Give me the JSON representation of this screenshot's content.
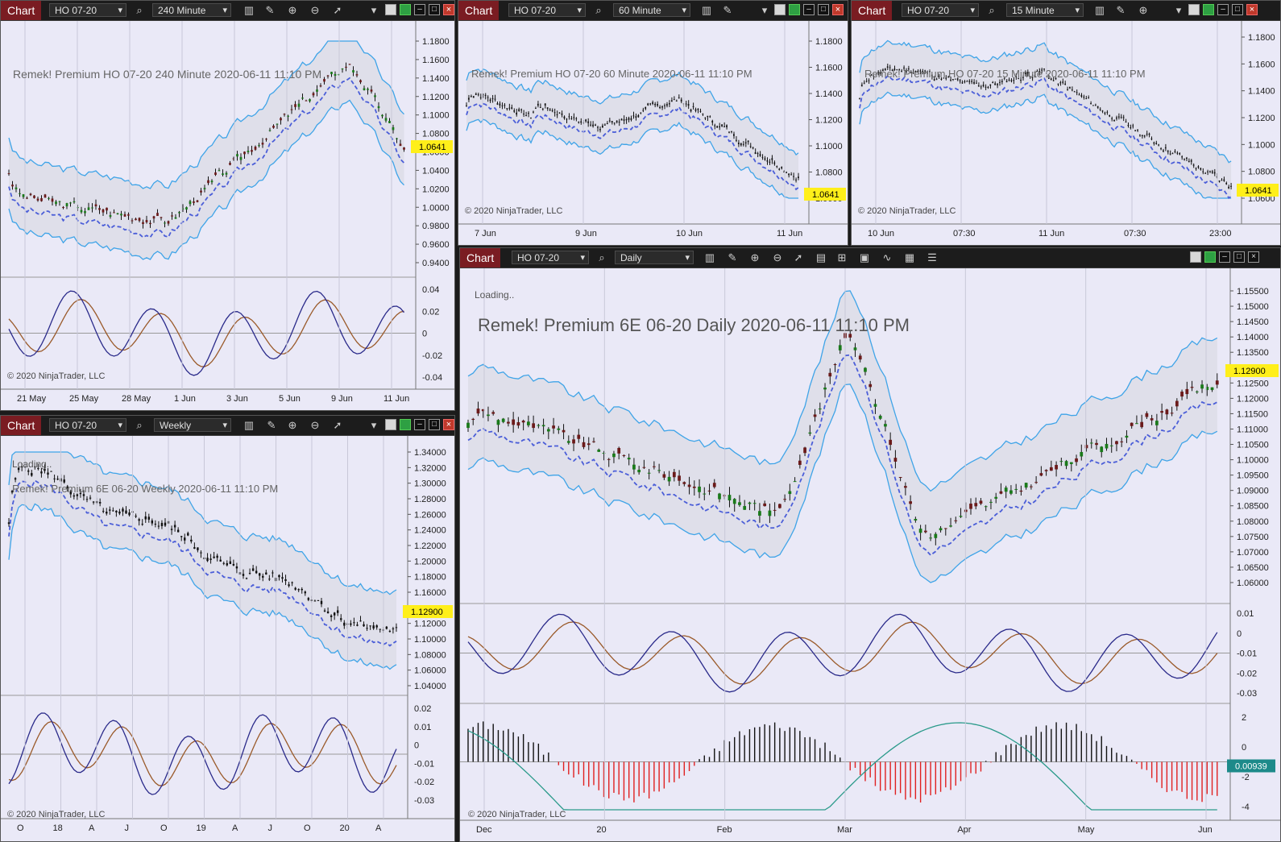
{
  "app": {
    "chart_tag": "Chart",
    "copyright": "© 2020 NinjaTrader, LLC",
    "loading": "Loading.."
  },
  "windows": [
    {
      "id": "w1",
      "instrument": "HO 07-20",
      "interval": "240 Minute",
      "title": "Remek!  Premium  HO 07-20  240 Minute  2020-06-11 11:10 PM",
      "price_marker": "1.0641",
      "price_ticks": [
        "1.1800",
        "1.1600",
        "1.1400",
        "1.1200",
        "1.1000",
        "1.0800",
        "1.0600",
        "1.0400",
        "1.0200",
        "1.0000",
        "0.9800",
        "0.9600",
        "0.9400"
      ],
      "osc_ticks": [
        "0.04",
        "0.02",
        "0",
        "-0.02",
        "-0.04"
      ],
      "x_ticks": [
        "21 May",
        "25 May",
        "28 May",
        "1 Jun",
        "3 Jun",
        "5 Jun",
        "9 Jun",
        "11 Jun"
      ]
    },
    {
      "id": "w2",
      "instrument": "HO 07-20",
      "interval": "60 Minute",
      "title": "Remek!  Premium  HO 07-20  60 Minute  2020-06-11 11:10 PM",
      "price_marker": "1.0641",
      "price_ticks": [
        "1.1800",
        "1.1600",
        "1.1400",
        "1.1200",
        "1.1000",
        "1.0800",
        "1.0600"
      ],
      "x_ticks": [
        "7 Jun",
        "9 Jun",
        "10 Jun",
        "11 Jun"
      ]
    },
    {
      "id": "w3",
      "instrument": "HO 07-20",
      "interval": "15 Minute",
      "title": "Remek!  Premium  HO 07-20  15 Minute  2020-06-11 11:10 PM",
      "price_marker": "1.0641",
      "price_ticks": [
        "1.1800",
        "1.1600",
        "1.1400",
        "1.1200",
        "1.1000",
        "1.0800",
        "1.0600"
      ],
      "x_ticks": [
        "10 Jun",
        "07:30",
        "11 Jun",
        "07:30",
        "23:00"
      ]
    },
    {
      "id": "w4",
      "instrument": "HO 07-20",
      "interval": "Weekly",
      "title": "Remek!  Premium  6E 06-20  Weekly  2020-06-11 11:10 PM",
      "price_marker": "1.12900",
      "price_ticks": [
        "1.34000",
        "1.32000",
        "1.30000",
        "1.28000",
        "1.26000",
        "1.24000",
        "1.22000",
        "1.20000",
        "1.18000",
        "1.16000",
        "1.14000",
        "1.12000",
        "1.10000",
        "1.08000",
        "1.06000",
        "1.04000"
      ],
      "osc_ticks": [
        "0.02",
        "0.01",
        "0",
        "-0.01",
        "-0.02",
        "-0.03"
      ],
      "x_ticks": [
        "O",
        "18",
        "A",
        "J",
        "O",
        "19",
        "A",
        "J",
        "O",
        "20",
        "A"
      ]
    },
    {
      "id": "w5",
      "instrument": "HO 07-20",
      "interval": "Daily",
      "title": "Remek!  Premium  6E 06-20  Daily  2020-06-11 11:10 PM",
      "price_marker": "1.12900",
      "hist_marker": "0.00939",
      "price_ticks": [
        "1.15500",
        "1.15000",
        "1.14500",
        "1.14000",
        "1.13500",
        "1.13000",
        "1.12500",
        "1.12000",
        "1.11500",
        "1.11000",
        "1.10500",
        "1.10000",
        "1.09500",
        "1.09000",
        "1.08500",
        "1.08000",
        "1.07500",
        "1.07000",
        "1.06500",
        "1.06000"
      ],
      "osc_ticks": [
        "0.01",
        "0",
        "-0.01",
        "-0.02",
        "-0.03"
      ],
      "hist_ticks": [
        "2",
        "0",
        "-2",
        "-4"
      ],
      "x_ticks": [
        "Dec",
        "20",
        "Feb",
        "Mar",
        "Apr",
        "May",
        "Jun"
      ]
    }
  ]
}
